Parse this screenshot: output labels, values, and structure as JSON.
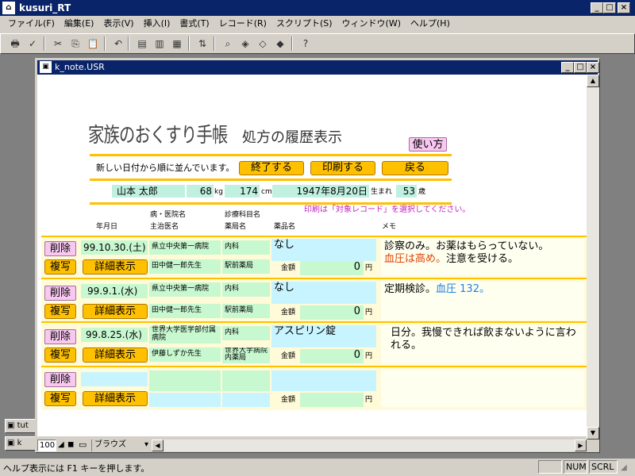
{
  "app": {
    "title": "kusuri_RT"
  },
  "menu": [
    "ファイル(F)",
    "編集(E)",
    "表示(V)",
    "挿入(I)",
    "書式(T)",
    "レコード(R)",
    "スクリプト(S)",
    "ウィンドウ(W)",
    "ヘルプ(H)"
  ],
  "window": {
    "title": "k_note.USR"
  },
  "header": {
    "title_main": "家族のおくすり手帳",
    "title_sub": "処方の履歴表示",
    "howto": "使い方",
    "order_note": "新しい日付から順に並んでいます。",
    "end_btn": "終了する",
    "print_btn": "印刷する",
    "back_btn": "戻る",
    "print_note": "印刷は「対象レコード」を選択してください。"
  },
  "patient": {
    "name": "山本 太郎",
    "weight": "68",
    "weight_unit": "kg",
    "height": "174",
    "height_unit": "cm",
    "birth": "1947年8月20日",
    "birth_label": "生まれ",
    "age": "53",
    "age_unit": "歳"
  },
  "columns": {
    "date": "年月日",
    "hospital": "病・医院名",
    "doctor": "主治医名",
    "dept": "診療科目名",
    "pharmacy": "薬局名",
    "drug": "薬品名",
    "memo": "メモ"
  },
  "buttons": {
    "delete": "削除",
    "copy": "複写",
    "detail": "詳細表示"
  },
  "amount_label": "金額",
  "yen": "円",
  "records": [
    {
      "date": "99.10.30.(土)",
      "hospital": "県立中央第一病院",
      "doctor": "田中健一郎先生",
      "dept": "内科",
      "pharmacy": "駅前薬局",
      "drug": "なし",
      "amount": "0",
      "memo1": "診察のみ。お薬はもらっていない。",
      "memo_red": "血圧は高め。",
      "memo2": "注意を受ける。"
    },
    {
      "date": "99.9.1.(水)",
      "hospital": "県立中央第一病院",
      "doctor": "田中健一郎先生",
      "dept": "内科",
      "pharmacy": "駅前薬局",
      "drug": "なし",
      "amount": "0",
      "memo1": "定期検診。",
      "memo_blue": "血圧 132。"
    },
    {
      "date": "99.8.25.(水)",
      "hospital": "世界大学医学部付属病院",
      "doctor": "伊藤しずか先生",
      "dept": "内科",
      "pharmacy": "世界大学病院内薬局",
      "drug": "アスピリン錠",
      "amount": "0",
      "memo1": "日分。我慢できれば飲まないように言われる。"
    }
  ],
  "bottom": {
    "zoom": "100",
    "mode": "ブラウズ"
  },
  "status": {
    "help": "ヘルプ表示には F1 キーを押します。",
    "num": "NUM",
    "scrl": "SCRL"
  }
}
